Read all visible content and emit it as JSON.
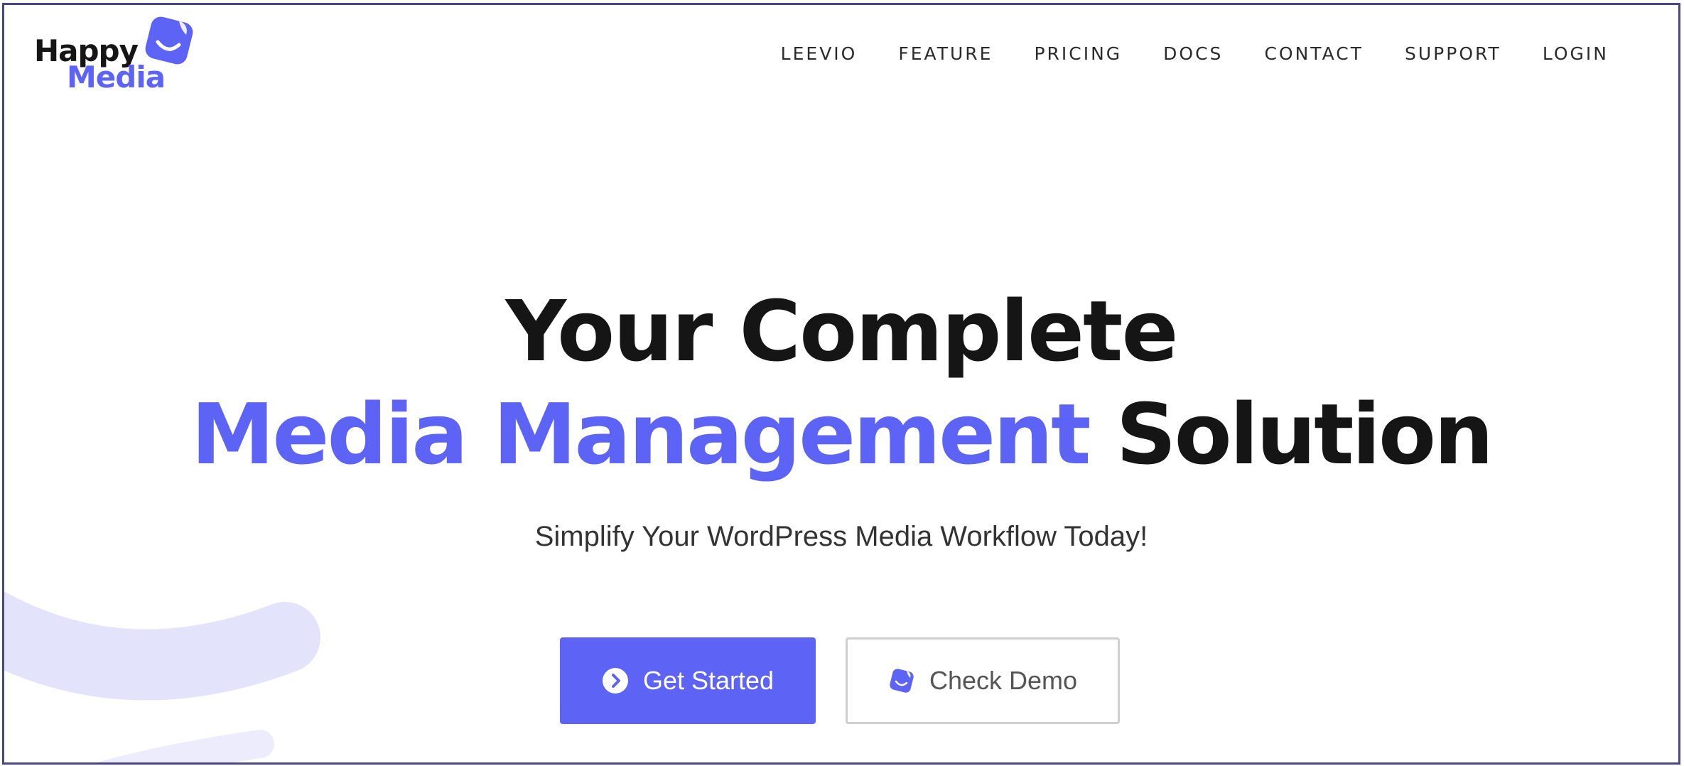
{
  "brand": {
    "logo_line1": "Happy",
    "logo_line2": "Media",
    "accent_color": "#5c63f5",
    "text_color": "#151515"
  },
  "nav": {
    "items": [
      {
        "label": "LEEVIO"
      },
      {
        "label": "FEATURE"
      },
      {
        "label": "PRICING"
      },
      {
        "label": "DOCS"
      },
      {
        "label": "CONTACT"
      },
      {
        "label": "SUPPORT"
      },
      {
        "label": "LOGIN"
      }
    ]
  },
  "hero": {
    "title_line1": "Your Complete",
    "title_highlight": "Media Management",
    "title_rest": "Solution",
    "subtitle": "Simplify Your WordPress Media Workflow Today!"
  },
  "actions": {
    "primary_label": "Get Started",
    "primary_icon": "chevron-right-circle-icon",
    "secondary_label": "Check Demo",
    "secondary_icon": "happy-media-mark-icon"
  }
}
